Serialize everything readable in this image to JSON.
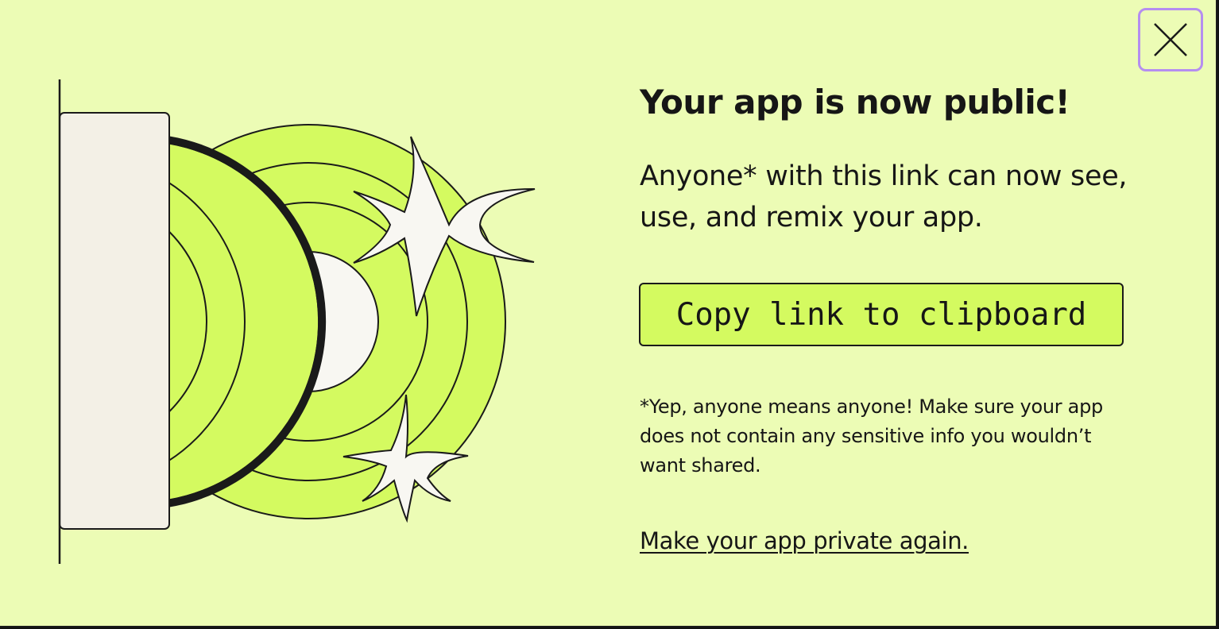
{
  "dialog": {
    "title": "Your app is now public!",
    "description": "Anyone* with this link can now see, use, and remix your app.",
    "copy_button_label": "Copy link to clipboard",
    "warning": "*Yep, anyone means anyone! Make sure your app does not contain any sensitive info you wouldn’t want shared.",
    "private_link_label": "Make your app private again.",
    "close_icon": "close-icon"
  },
  "colors": {
    "background": "#ecfcb5",
    "accent_green": "#d4fa60",
    "focus_ring": "#b58ef0",
    "text": "#161616"
  }
}
